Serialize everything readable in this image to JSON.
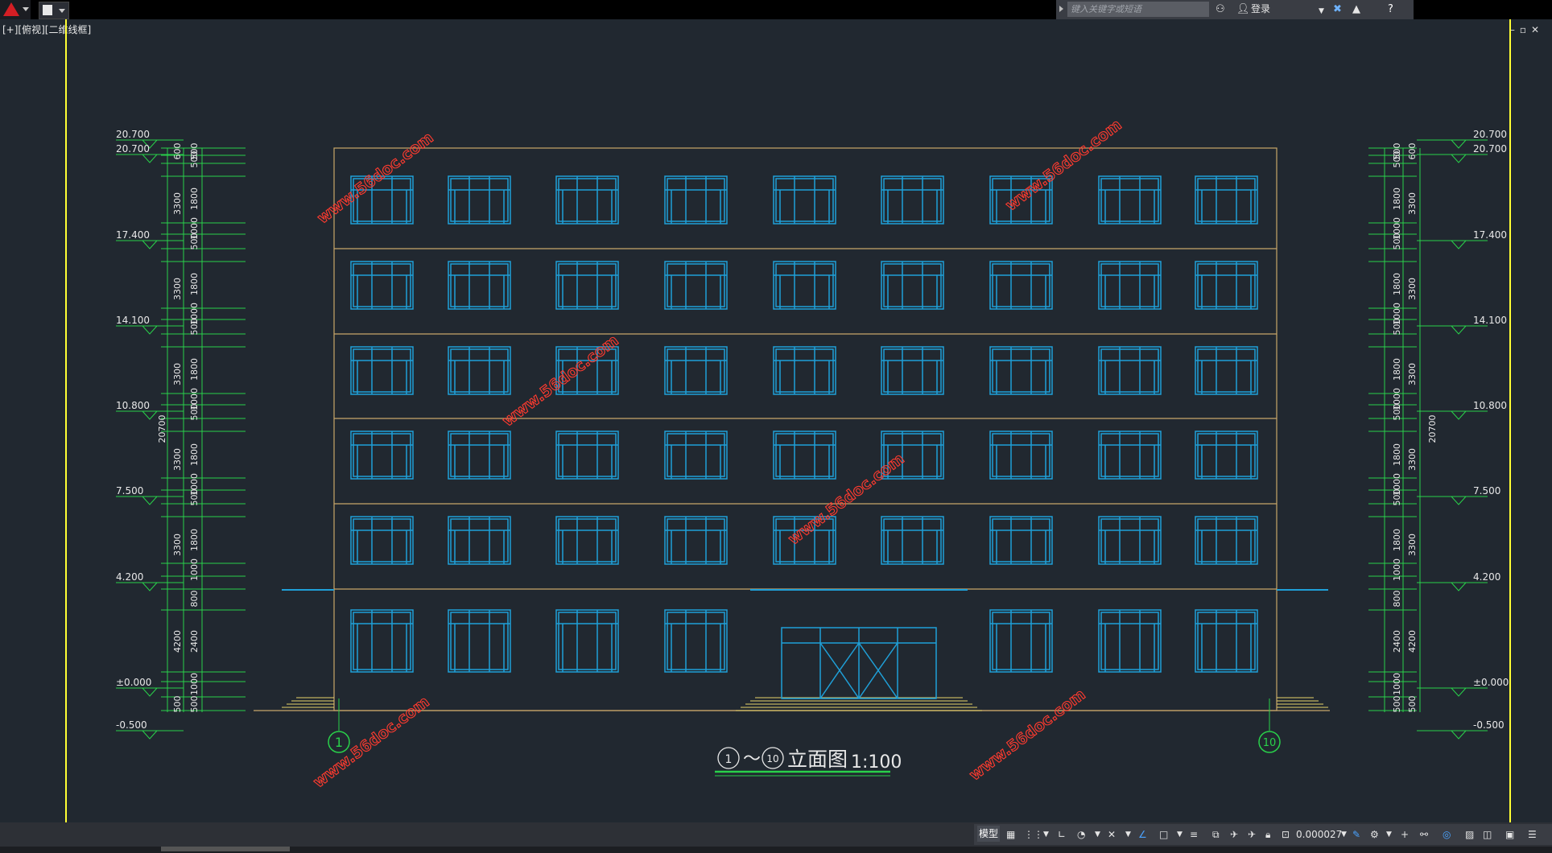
{
  "app": {
    "name": "AutoCAD"
  },
  "search": {
    "placeholder": "键入关键字或短语"
  },
  "infocenter": {
    "login_label": "登录"
  },
  "viewport": {
    "label": "[+][俯视][二维线框]"
  },
  "drawing": {
    "title_axes": [
      "1",
      "10"
    ],
    "title_separator": "～",
    "title_text": "立面图",
    "scale": "1:100",
    "axis_bubbles": [
      "1",
      "10"
    ],
    "watermark": "www.56doc.com",
    "left_levels": [
      "20.700",
      "20.700",
      "17.400",
      "14.100",
      "10.800",
      "7.500",
      "4.200",
      "±0.000",
      "-0.500"
    ],
    "right_levels": [
      "20.700",
      "20.700",
      "17.400",
      "14.100",
      "10.800",
      "7.500",
      "4.200",
      "±0.000",
      "-0.500"
    ],
    "dims_inner": [
      "600",
      "3300",
      "3300",
      "3300",
      "3300",
      "3300",
      "4200",
      "500"
    ],
    "dims_outer": [
      "500",
      "500",
      "1800",
      "1000",
      "500",
      "1800",
      "1000",
      "500",
      "1800",
      "1000",
      "500",
      "1800",
      "1000",
      "500",
      "1800",
      "1000",
      "800",
      "2400",
      "1000",
      "500"
    ],
    "total_height": "20700"
  },
  "status": {
    "model_tab": "模型",
    "scale_value": "0.000027"
  },
  "colors": {
    "background": "#212830",
    "window_cyan": "#1fa0d8",
    "outline": "#c8a66a",
    "dimension_green": "#29d14a",
    "watermark_red": "#ff3b2f",
    "guide_yellow": "#ffff33"
  }
}
